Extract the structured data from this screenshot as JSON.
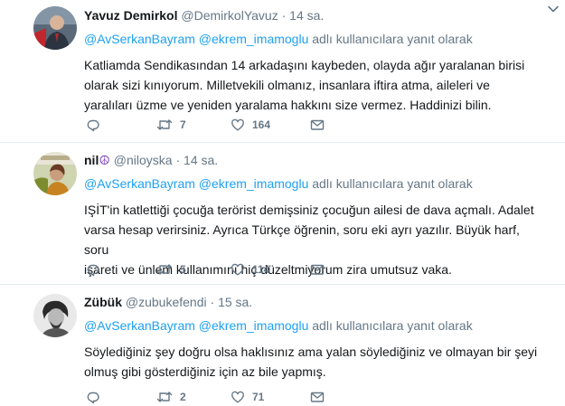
{
  "tweets": [
    {
      "fullname": "Yavuz Demirkol",
      "peace": "",
      "handle": "@DemirkolYavuz",
      "dot": "·",
      "time": "14 sa.",
      "reply": {
        "prefix": "",
        "mention1": "@AvSerkanBayram",
        "mention2": "@ekrem_imamoglu",
        "suffix": "adlı kullanıcılara yanıt olarak"
      },
      "lines": [
        "Katliamda Sendikasından 14 arkadaşını kaybeden, olayda ağır yaralanan birisi",
        "olarak sizi kınıyorum. Milletvekili olmanız,  insanlara iftira atma, aileleri ve",
        "yaralıları üzme ve yeniden yaralama hakkını size vermez. Haddinizi bilin."
      ],
      "retweets": "7",
      "likes": "164"
    },
    {
      "fullname": "nil",
      "peace": "☮",
      "handle": "@niloyska",
      "dot": "·",
      "time": "14 sa.",
      "reply": {
        "mention1": "@AvSerkanBayram",
        "mention2": "@ekrem_imamoglu",
        "suffix": "adlı kullanıcılara yanıt olarak"
      },
      "lines": [
        "IŞİT'in katlettiği çocuğa terörist demişsiniz çocuğun ailesi de dava açmalı. Adalet",
        "varsa hesap verirsiniz. Ayrıca Türkçe öğrenin, soru eki ayrı yazılır. Büyük harf, soru",
        "işareti ve ünlem kullanımını hiç düzeltmiyorum zira umutsuz vaka."
      ],
      "retweets": "5",
      "likes": "114"
    },
    {
      "fullname": "Zübük",
      "peace": "",
      "handle": "@zubukefendi",
      "dot": "·",
      "time": "15 sa.",
      "reply": {
        "mention1": "@AvSerkanBayram",
        "mention2": "@ekrem_imamoglu",
        "suffix": "adlı kullanıcılara yanıt olarak"
      },
      "lines": [
        "Söylediğiniz şey doğru olsa haklısınız ama yalan söylediğiniz ve olmayan bir şeyi",
        "olmuş gibi gösterdiğiniz için az bile yapmış."
      ],
      "retweets": "2",
      "likes": "71"
    }
  ],
  "colors": {
    "link": "#1da1f2",
    "muted": "#657786",
    "text": "#14171a",
    "divider": "#e6ecf0"
  },
  "icons": {
    "reply": "reply-icon",
    "retweet": "retweet-icon",
    "like": "heart-icon",
    "dm": "direct-message-icon",
    "menu": "chevron-down-icon"
  }
}
